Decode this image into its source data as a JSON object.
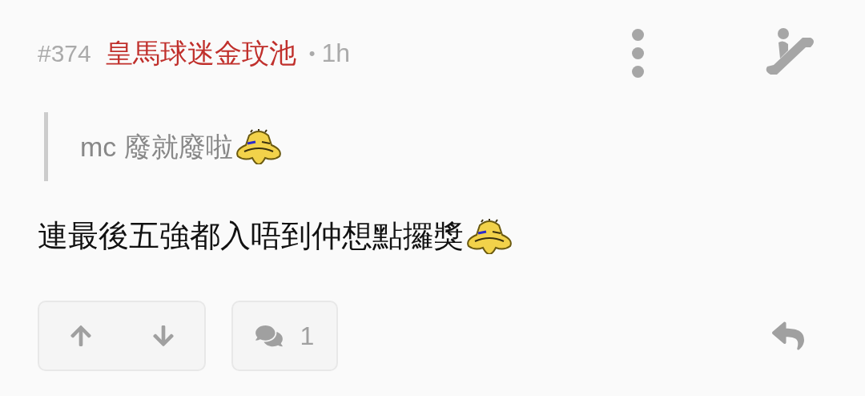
{
  "post": {
    "number": "#374",
    "author": "皇馬球迷金玟池",
    "separator": "•",
    "time": "1h"
  },
  "quote": {
    "text": "mc 廢就廢啦"
  },
  "body": {
    "text": "連最後五強都入唔到仲想點攞獎"
  },
  "actions": {
    "comment_count": "1"
  }
}
